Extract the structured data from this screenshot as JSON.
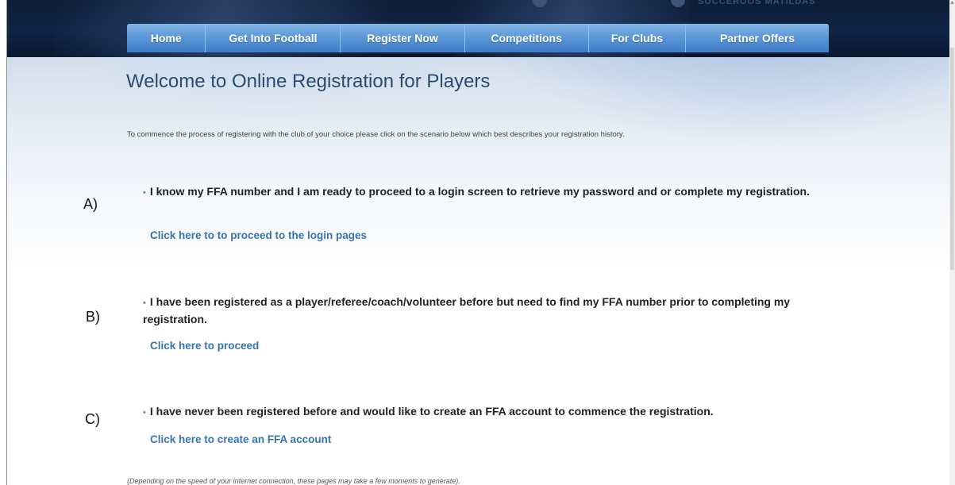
{
  "header": {
    "logo_text": "SOCCEROOS  MATILDAS"
  },
  "nav": {
    "items": [
      {
        "label": "Home"
      },
      {
        "label": "Get Into Football"
      },
      {
        "label": "Register Now"
      },
      {
        "label": "Competitions"
      },
      {
        "label": "For Clubs"
      },
      {
        "label": "Partner Offers"
      }
    ]
  },
  "main": {
    "title": "Welcome to Online Registration for Players",
    "intro": "To commence the process of registering with the club of your choice please click on the scenario below which best describes your registration history.",
    "options": [
      {
        "letter": "A)",
        "bullet": "•",
        "text": "I know my FFA number and I am ready to proceed to a login screen to retrieve my password and or complete my registration.",
        "link": "Click here to to proceed to the login pages"
      },
      {
        "letter": "B)",
        "bullet": "•",
        "text": "I have been registered as a player/referee/coach/volunteer before but need to find my FFA number prior to completing my registration.",
        "link": "Click here to proceed"
      },
      {
        "letter": "C)",
        "bullet": "•",
        "text": "I have never been registered before and would like to create an FFA account to commence the registration.",
        "link": "Click here to create an FFA account"
      }
    ],
    "note": "(Depending on the speed of your internet connection, these pages may take a few moments to generate)."
  },
  "colors": {
    "nav_bg": "#5994d6",
    "header_dark": "#102446",
    "title": "#2a4b70",
    "link": "#3573b5"
  },
  "icons": {
    "scroll_up": "up-arrow-icon",
    "bullet": "bullet-icon"
  }
}
